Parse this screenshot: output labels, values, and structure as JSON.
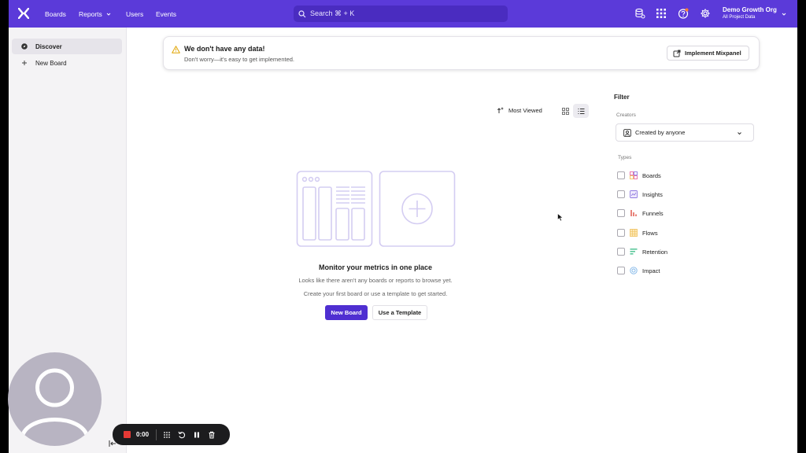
{
  "nav": {
    "boards": "Boards",
    "reports": "Reports",
    "users": "Users",
    "events": "Events",
    "search_placeholder": "Search ⌘ + K",
    "org_name": "Demo Growth Org",
    "org_sub": "All Project Data"
  },
  "sidebar": {
    "items": [
      {
        "label": "Discover",
        "icon": "compass-icon"
      },
      {
        "label": "New Board",
        "icon": "plus-icon"
      }
    ]
  },
  "banner": {
    "title": "We don't have any data!",
    "description": "Don't worry—it's easy to get implemented.",
    "action": "Implement Mixpanel"
  },
  "toolbar": {
    "sort": "Most Viewed"
  },
  "empty": {
    "title": "Monitor your metrics in one place",
    "line1": "Looks like there aren't any boards or reports to browse yet.",
    "line2": "Create your first board or use a template to get started.",
    "primary": "New Board",
    "secondary": "Use a Template"
  },
  "filter": {
    "title": "Filter",
    "creators_label": "Creators",
    "creators_value": "Created by anyone",
    "types_label": "Types",
    "types": [
      {
        "label": "Boards",
        "icon": "boards-icon",
        "color": "#e86aa6"
      },
      {
        "label": "Insights",
        "icon": "insights-icon",
        "color": "#8f7ae0"
      },
      {
        "label": "Funnels",
        "icon": "funnels-icon",
        "color": "#e8837a"
      },
      {
        "label": "Flows",
        "icon": "flows-icon",
        "color": "#f0c15c"
      },
      {
        "label": "Retention",
        "icon": "retention-icon",
        "color": "#5cc79b"
      },
      {
        "label": "Impact",
        "icon": "impact-icon",
        "color": "#7fb6e8"
      }
    ]
  },
  "recorder": {
    "time": "0:00"
  },
  "colors": {
    "brand": "#5b3ad9",
    "primary_button": "#4f2fd1"
  }
}
